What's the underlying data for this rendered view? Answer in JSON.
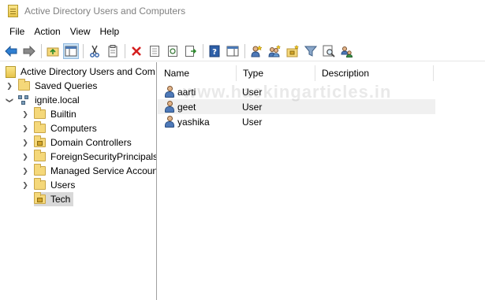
{
  "window": {
    "title": "Active Directory Users and Computers"
  },
  "menu": [
    "File",
    "Action",
    "View",
    "Help"
  ],
  "toolbar": {
    "icons": [
      "back-arrow-icon",
      "forward-arrow-icon",
      "up-folder-icon",
      "show-console-tree-icon",
      "cut-icon",
      "copy-icon",
      "delete-icon",
      "properties-icon",
      "refresh-icon",
      "export-list-icon",
      "help-icon",
      "show-action-pane-icon",
      "new-user-icon",
      "new-group-icon",
      "new-ou-icon",
      "filter-icon",
      "find-icon",
      "add-to-group-icon"
    ]
  },
  "tree": {
    "root": "Active Directory Users and Com",
    "saved_queries": "Saved Queries",
    "domain": "ignite.local",
    "children": [
      "Builtin",
      "Computers",
      "Domain Controllers",
      "ForeignSecurityPrincipals",
      "Managed Service Accoun",
      "Users",
      "Tech"
    ]
  },
  "list": {
    "columns": [
      "Name",
      "Type",
      "Description"
    ],
    "rows": [
      {
        "name": "aarti",
        "type": "User"
      },
      {
        "name": "geet",
        "type": "User"
      },
      {
        "name": "yashika",
        "type": "User"
      }
    ]
  },
  "watermark": "www.hackingarticles.in",
  "colors": {
    "selection": "#d9d9d9",
    "folder": "#f5d87a",
    "accent": "#1e5fb3"
  }
}
